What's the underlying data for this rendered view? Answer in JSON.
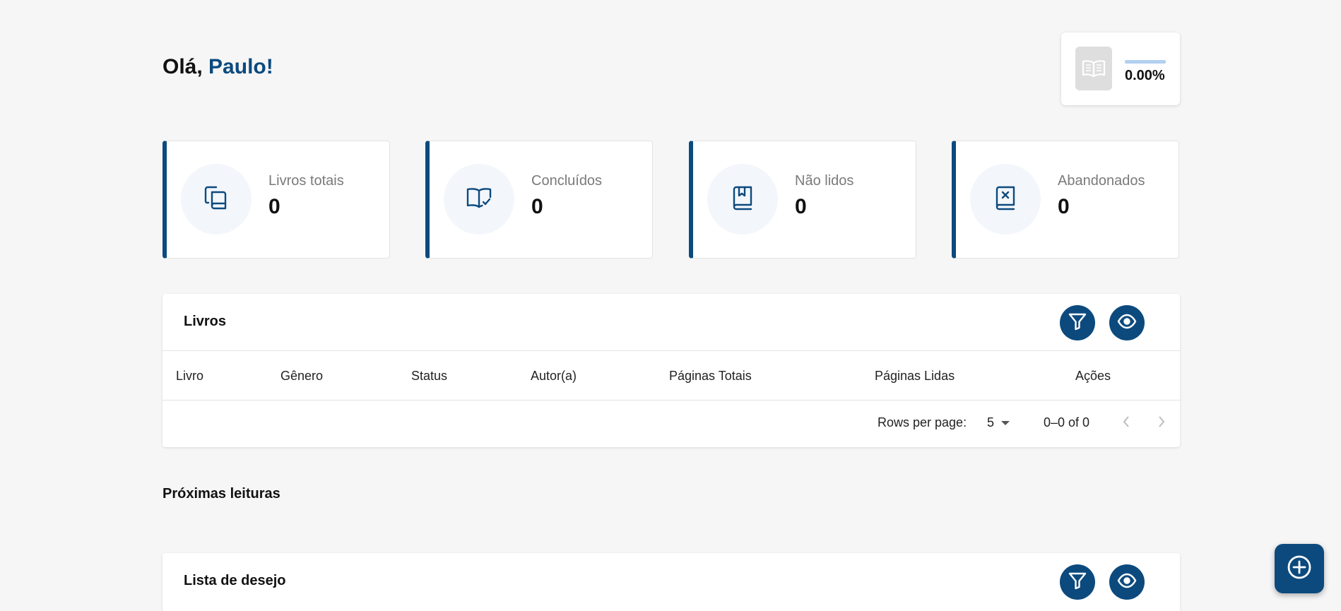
{
  "greeting": {
    "prefix": "Olá,",
    "name": "Paulo!"
  },
  "reading_progress": {
    "value_text": "0.00%",
    "fraction": 0.0,
    "icon": "open-book-icon"
  },
  "stats": [
    {
      "label": "Livros totais",
      "value": "0",
      "icon": "books-copy-icon"
    },
    {
      "label": "Concluídos",
      "value": "0",
      "icon": "book-check-icon"
    },
    {
      "label": "Não lidos",
      "value": "0",
      "icon": "bookmark-book-icon"
    },
    {
      "label": "Abandonados",
      "value": "0",
      "icon": "book-x-icon"
    }
  ],
  "books_panel": {
    "title": "Livros",
    "columns": [
      "Livro",
      "Gênero",
      "Status",
      "Autor(a)",
      "Páginas Totais",
      "Páginas Lidas",
      "Ações"
    ],
    "rows": [],
    "pagination": {
      "rows_per_page_label": "Rows per page:",
      "rows_per_page_value": "5",
      "range_text": "0–0 of 0"
    }
  },
  "next_reads": {
    "title": "Próximas leituras"
  },
  "wishlist_panel": {
    "title": "Lista de desejo"
  },
  "colors": {
    "primary": "#0c4a7e",
    "background": "#f6f6f6",
    "stat_label": "#7a7a7a",
    "progress_track": "#b3d0f0"
  }
}
